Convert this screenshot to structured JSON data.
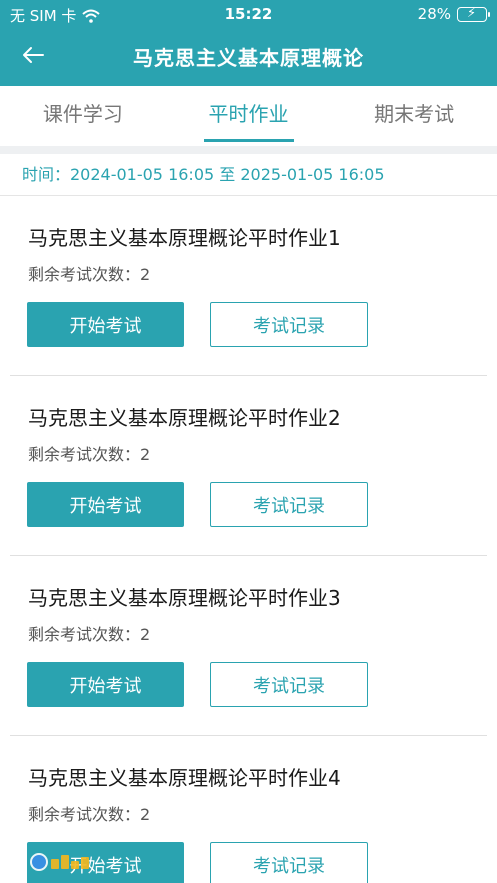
{
  "status_bar": {
    "carrier": "无 SIM 卡",
    "time": "15:22",
    "battery": "28%"
  },
  "nav": {
    "title": "马克思主义基本原理概论"
  },
  "tabs": [
    {
      "label": "课件学习",
      "active": false
    },
    {
      "label": "平时作业",
      "active": true
    },
    {
      "label": "期末考试",
      "active": false
    }
  ],
  "time_range": "时间：2024-01-05 16:05 至 2025-01-05 16:05",
  "assignments": [
    {
      "title": "马克思主义基本原理概论平时作业1",
      "remaining": "剩余考试次数：2",
      "start_label": "开始考试",
      "record_label": "考试记录"
    },
    {
      "title": "马克思主义基本原理概论平时作业2",
      "remaining": "剩余考试次数：2",
      "start_label": "开始考试",
      "record_label": "考试记录"
    },
    {
      "title": "马克思主义基本原理概论平时作业3",
      "remaining": "剩余考试次数：2",
      "start_label": "开始考试",
      "record_label": "考试记录"
    },
    {
      "title": "马克思主义基本原理概论平时作业4",
      "remaining": "剩余考试次数：2",
      "start_label": "开始考试",
      "record_label": "考试记录"
    }
  ],
  "colors": {
    "accent": "#2aa3b0",
    "tab_inactive": "#777777",
    "divider": "#e0e0e0"
  }
}
